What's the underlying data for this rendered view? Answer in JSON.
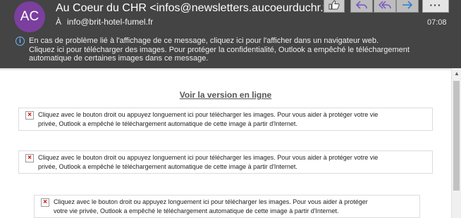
{
  "header": {
    "avatar_initials": "AC",
    "sender": "Au Coeur du CHR <infos@newsletters.aucoeurduchr.fr",
    "to_label": "À",
    "recipient": "info@brit-hotel-fumel.fr",
    "time": "07:08",
    "actions": {
      "like_icon": "thumbs-up-icon",
      "reply_icon": "reply-icon",
      "reply_all_icon": "reply-all-icon",
      "forward_icon": "forward-icon",
      "more_label": "···"
    },
    "info": {
      "line1": "En cas de problème lié à l'affichage de ce message, cliquez ici pour l'afficher dans un navigateur web.",
      "line2": "Cliquez ici pour télécharger des images. Pour protéger la confidentialité, Outlook a empêché le téléchargement",
      "line3": "automatique de certaines images dans ce message."
    },
    "colors": {
      "background": "#444444",
      "avatar": "#7b3f9e",
      "info_icon": "#6fb7ff"
    }
  },
  "body": {
    "online_link": "Voir la version en ligne",
    "placeholders": [
      {
        "line1": "Cliquez avec le bouton droit ou appuyez longuement ici pour télécharger les images. Pour vous aider à protéger votre vie",
        "line2": "privée, Outlook a empêché le téléchargement automatique de cette image à partir d'Internet."
      },
      {
        "line1": "Cliquez avec le bouton droit ou appuyez longuement ici pour télécharger les images. Pour vous aider à protéger votre vie",
        "line2": "privée, Outlook a empêché le téléchargement automatique de cette image à partir d'Internet."
      },
      {
        "line1": "Cliquez avec le bouton droit ou appuyez longuement ici pour télécharger les images. Pour vous aider à protéger",
        "line2": "votre vie privée, Outlook a empêché le téléchargement automatique de cette image à partir d'Internet."
      }
    ]
  }
}
